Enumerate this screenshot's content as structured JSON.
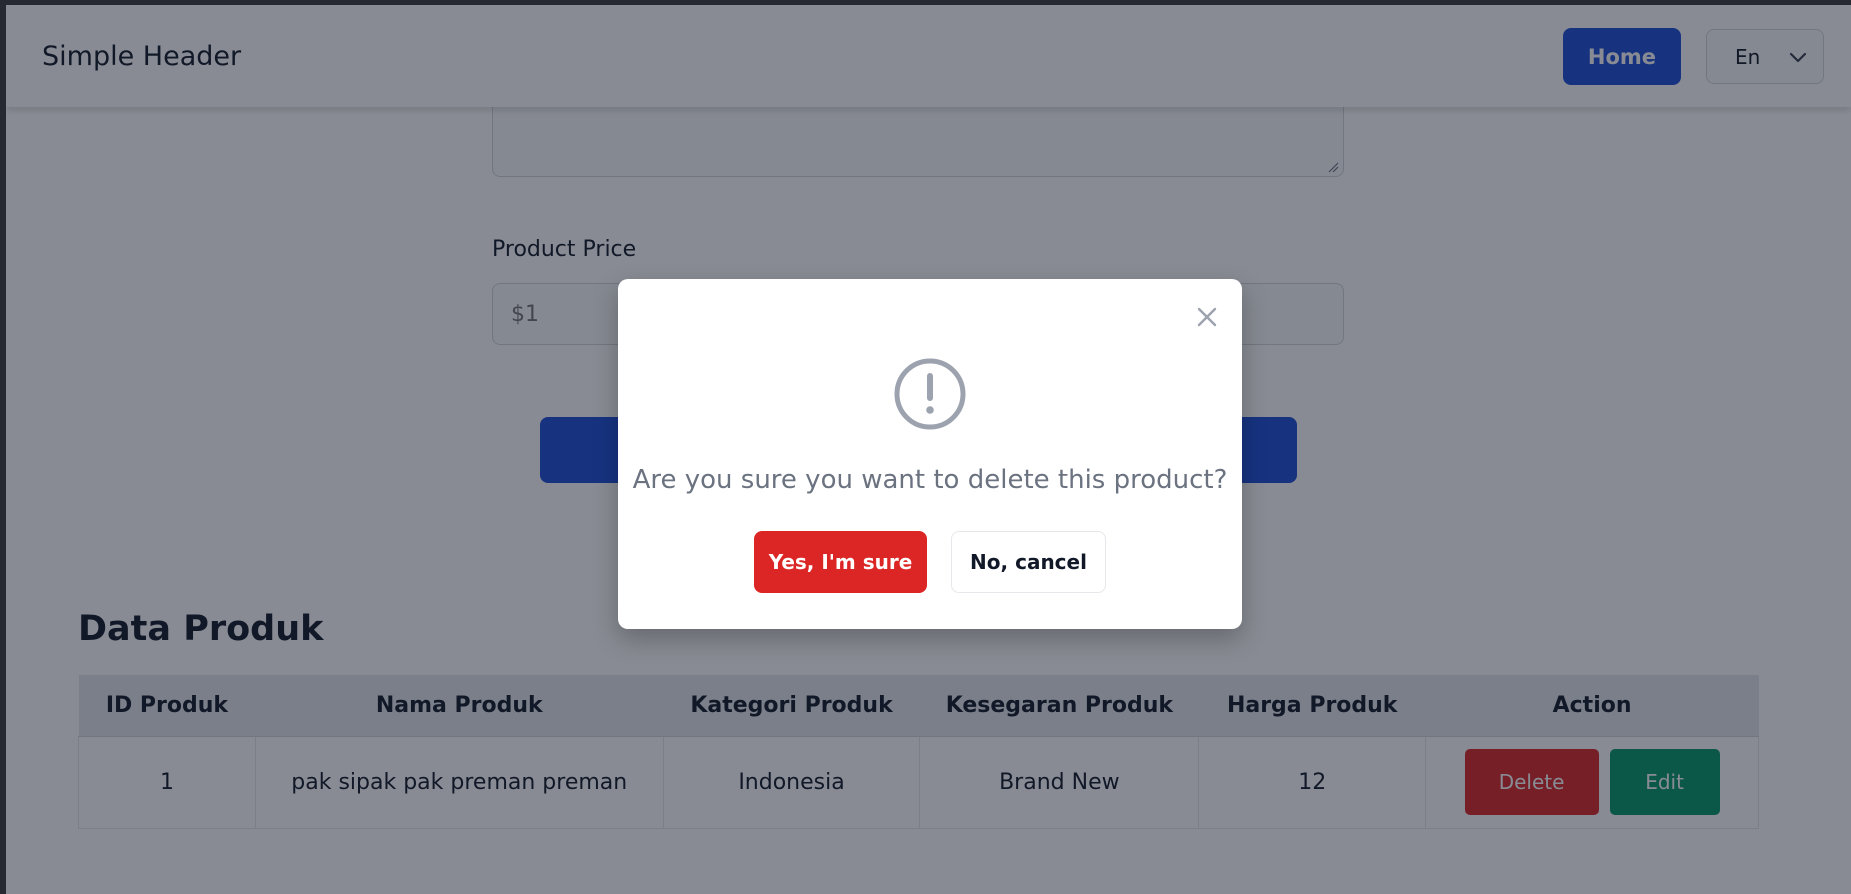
{
  "header": {
    "brand": "Simple Header",
    "home_label": "Home",
    "language": "En",
    "accent_color": "#1d4ed8"
  },
  "form": {
    "price_label": "Product Price",
    "price_placeholder": "$1"
  },
  "data_section": {
    "title": "Data Produk",
    "columns": [
      "ID Produk",
      "Nama Produk",
      "Kategori Produk",
      "Kesegaran Produk",
      "Harga Produk",
      "Action"
    ],
    "rows": [
      {
        "id": "1",
        "name": "pak sipak pak preman preman",
        "category": "Indonesia",
        "freshness": "Brand New",
        "price": "12",
        "delete_label": "Delete",
        "edit_label": "Edit"
      }
    ]
  },
  "modal": {
    "message": "Are you sure you want to delete this product?",
    "confirm_label": "Yes, I'm sure",
    "cancel_label": "No, cancel",
    "icon": "exclamation-circle-icon",
    "danger_color": "#dc2626"
  }
}
